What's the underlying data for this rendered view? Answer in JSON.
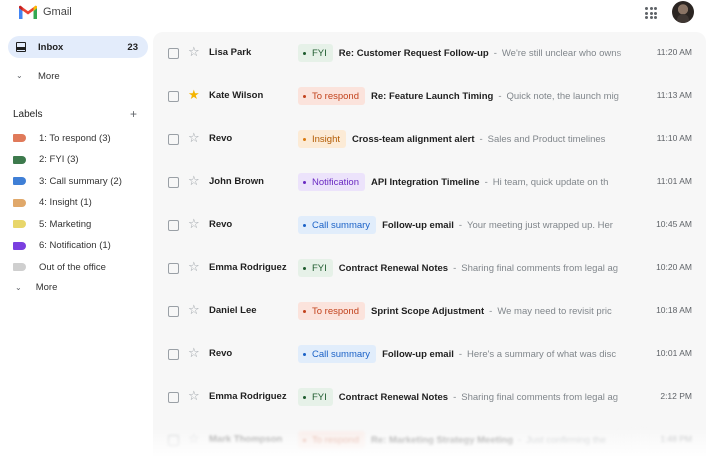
{
  "app": {
    "name": "Gmail"
  },
  "colors": {
    "brand_red": "#ea4335",
    "brand_blue": "#4285f4",
    "brand_green": "#34a853",
    "brand_yellow": "#fbbc04"
  },
  "icons": {
    "apps": "apps-grid-icon",
    "star": "star-icon",
    "checkbox": "checkbox-icon",
    "inbox": "inbox-icon",
    "more": "chevron-down-icon",
    "add": "plus-icon"
  },
  "sidebar": {
    "inbox": {
      "label": "Inbox",
      "count": "23"
    },
    "more": {
      "label": "More"
    },
    "labels_title": "Labels",
    "labels_add": "+",
    "labels": [
      {
        "text": "1: To respond (3)",
        "color": "#e07a5a"
      },
      {
        "text": "2: FYI (3)",
        "color": "#3d7a4d"
      },
      {
        "text": "3: Call summary (2)",
        "color": "#3f7fd6"
      },
      {
        "text": "4: Insight (1)",
        "color": "#e0a86a"
      },
      {
        "text": "5: Marketing",
        "color": "#e8d66a"
      },
      {
        "text": "6: Notification (1)",
        "color": "#7a3fe0"
      },
      {
        "text": "Out of the office",
        "color": "#cfcfcf"
      }
    ],
    "labels_more": {
      "label": "More"
    }
  },
  "emails": [
    {
      "sender": "Lisa Park",
      "starred": false,
      "label": "FYI",
      "label_kind": "fyi",
      "subject": "Re: Customer Request Follow-up",
      "snippet": "We're still unclear who owns",
      "time": "11:20 AM"
    },
    {
      "sender": "Kate Wilson",
      "starred": true,
      "label": "To respond",
      "label_kind": "respond",
      "subject": "Re: Feature Launch Timing",
      "snippet": "Quick note, the launch mig",
      "time": "11:13 AM"
    },
    {
      "sender": "Revo",
      "starred": false,
      "label": "Insight",
      "label_kind": "insight",
      "subject": "Cross-team alignment alert",
      "snippet": "Sales and Product timelines",
      "time": "11:10 AM"
    },
    {
      "sender": "John Brown",
      "starred": false,
      "label": "Notification",
      "label_kind": "notification",
      "subject": "API Integration Timeline",
      "snippet": "Hi team, quick update on th",
      "time": "11:01 AM"
    },
    {
      "sender": "Revo",
      "starred": false,
      "label": "Call summary",
      "label_kind": "call",
      "subject": "Follow-up email",
      "snippet": "Your meeting just wrapped up. Her",
      "time": "10:45 AM"
    },
    {
      "sender": "Emma Rodriguez",
      "starred": false,
      "label": "FYI",
      "label_kind": "fyi",
      "subject": "Contract Renewal Notes",
      "snippet": "Sharing final comments from legal ag",
      "time": "10:20 AM"
    },
    {
      "sender": "Daniel Lee",
      "starred": false,
      "label": "To respond",
      "label_kind": "respond",
      "subject": "Sprint Scope Adjustment",
      "snippet": "We may need to revisit pric",
      "time": "10:18 AM"
    },
    {
      "sender": "Revo",
      "starred": false,
      "label": "Call summary",
      "label_kind": "call",
      "subject": "Follow-up email",
      "snippet": "Here's a summary of what was disc",
      "time": "10:01 AM"
    },
    {
      "sender": "Emma Rodriguez",
      "starred": false,
      "label": "FYI",
      "label_kind": "fyi",
      "subject": "Contract Renewal Notes",
      "snippet": "Sharing final comments from legal ag",
      "time": "2:12 PM"
    },
    {
      "sender": "Mark Thompson",
      "starred": false,
      "label": "To respond",
      "label_kind": "respond",
      "subject": "Re: Marketing Strategy Meeting",
      "snippet": "Just confirming the",
      "time": "1:48 PM"
    }
  ]
}
